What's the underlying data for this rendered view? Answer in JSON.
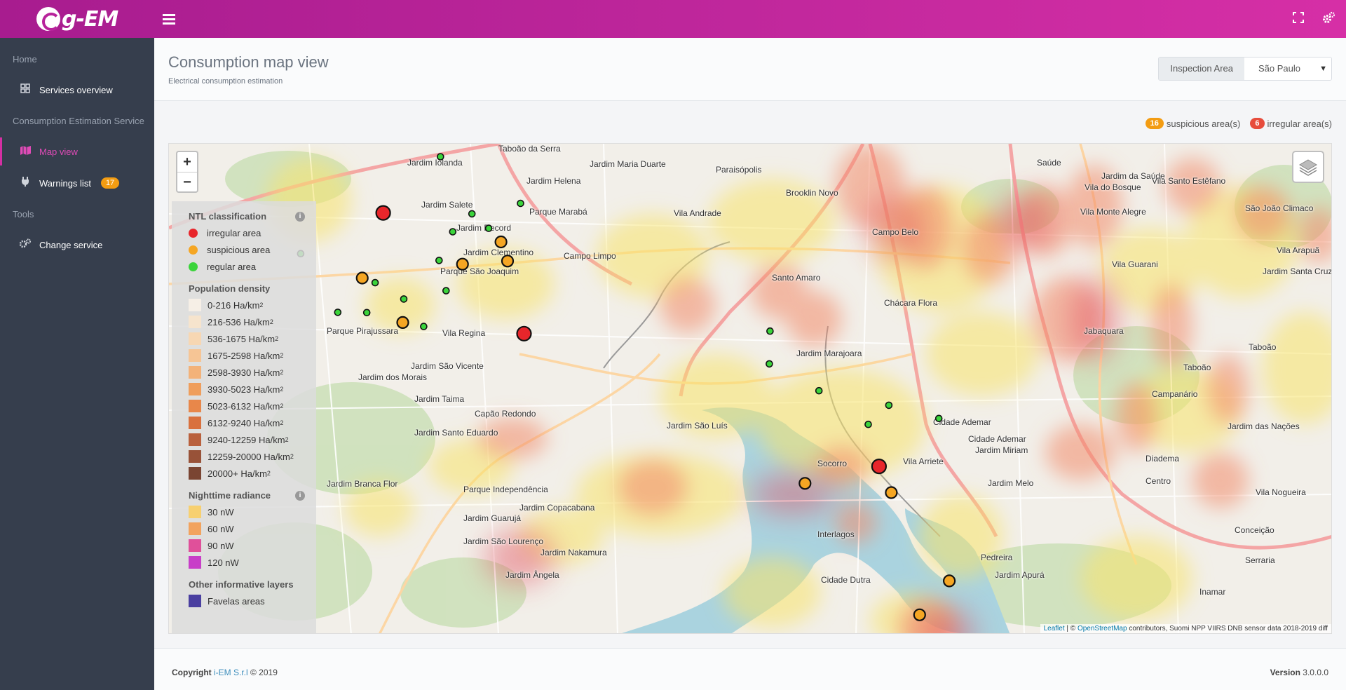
{
  "app": {
    "logo": "g-EM"
  },
  "sidebar": {
    "headers": {
      "home": "Home",
      "service": "Consumption Estimation Service",
      "tools": "Tools"
    },
    "items": [
      {
        "label": "Services overview",
        "icon": "grid-icon"
      },
      {
        "label": "Map view",
        "icon": "map-icon"
      },
      {
        "label": "Warnings list",
        "icon": "plug-icon",
        "badge": "17"
      },
      {
        "label": "Change service",
        "icon": "cogs-icon"
      }
    ]
  },
  "page": {
    "title": "Consumption map view",
    "subtitle": "Electrical consumption estimation"
  },
  "inspection": {
    "label": "Inspection Area",
    "value": "São Paulo"
  },
  "counters": {
    "suspicious_count": "16",
    "suspicious_label": "suspicious area(s)",
    "irregular_count": "6",
    "irregular_label": "irregular area(s)"
  },
  "legend": {
    "ntl_title": "NTL classification",
    "ntl": [
      {
        "label": "irregular area",
        "color": "#e8262b"
      },
      {
        "label": "suspicious area",
        "color": "#f5a623"
      },
      {
        "label": "regular area",
        "color": "#3bd43b"
      }
    ],
    "pop_title": "Population density",
    "pop": [
      {
        "label": "0-216 Ha/km",
        "color": "#f6efe6"
      },
      {
        "label": "216-536 Ha/km",
        "color": "#f6e4cd"
      },
      {
        "label": "536-1675 Ha/km",
        "color": "#f7d7b3"
      },
      {
        "label": "1675-2598 Ha/km",
        "color": "#f6c595"
      },
      {
        "label": "2598-3930 Ha/km",
        "color": "#f3b279"
      },
      {
        "label": "3930-5023 Ha/km",
        "color": "#ef9e5c"
      },
      {
        "label": "5023-6132 Ha/km",
        "color": "#e8874a"
      },
      {
        "label": "6132-9240 Ha/km",
        "color": "#d9713e"
      },
      {
        "label": "9240-12259 Ha/km",
        "color": "#b9603c"
      },
      {
        "label": "12259-20000 Ha/km",
        "color": "#985238"
      },
      {
        "label": "20000+ Ha/km",
        "color": "#7a4532"
      }
    ],
    "rad_title": "Nighttime radiance",
    "rad": [
      {
        "label": "30 nW",
        "color": "#f7d070"
      },
      {
        "label": "60 nW",
        "color": "#f2a35e"
      },
      {
        "label": "90 nW",
        "color": "#e0509a"
      },
      {
        "label": "120 nW",
        "color": "#c83ec8"
      }
    ],
    "other_title": "Other informative layers",
    "other": [
      {
        "label": "Favelas areas",
        "color": "#4a3fa0"
      }
    ]
  },
  "map": {
    "zoom_in": "+",
    "zoom_out": "−",
    "attribution_leaflet": "Leaflet",
    "attribution_sep": " | © ",
    "attribution_osm": "OpenStreetMap",
    "attribution_rest": " contributors, Suomi NPP VIIRS DNB sensor data 2018-2019 diff",
    "labels": [
      "Taboão da Serra",
      "Jardim Iolanda",
      "Jardim Helena",
      "Jardim Maria Duarte",
      "Paraisópolis",
      "Jardim Salete",
      "Jardim Record",
      "Parque Marabá",
      "Vila Andrade",
      "Brooklin Novo",
      "Campo Belo",
      "Saúde",
      "Vila do Bosque",
      "Jardim da Saúde",
      "Vila Santo Estêfano",
      "São João Climaco",
      "Vila Monte Alegre",
      "Jardim Clementino",
      "Campo Limpo",
      "Santo Amaro",
      "Vila Guarani",
      "Vila Arapuã",
      "Jardim Santa Cruz",
      "Parque São Joaquim",
      "Chácara Flora",
      "Jabaquara",
      "Parque Pirajussara",
      "Vila Regina",
      "Jardim Marajoara",
      "Jardim São Vicente",
      "Jardim dos Morais",
      "Jardim Taima",
      "Taboão",
      "Campanário",
      "Capão Redondo",
      "Jardim São Luís",
      "Cidade Ademar",
      "Jardim Santo Eduardo",
      "Cidade Ademar",
      "Jardim Miriam",
      "Diadema",
      "Jardim das Nações",
      "Parque Independência",
      "Socorro",
      "Vila Arriete",
      "Jardim Melo",
      "Centro",
      "Jardim Branca Flor",
      "Jardim Copacabana",
      "Jardim Guarujá",
      "Vila Nogueira",
      "Conceição",
      "Interlagos",
      "Jardim São Lourenço",
      "Jardim Nakamura",
      "Pedreira",
      "Serraria",
      "Jardim Ângela",
      "Cidade Dutra",
      "Jardim Apurá",
      "Inamar",
      "Taboão"
    ],
    "points": [
      {
        "cls": "irregular",
        "lat": -23.6234,
        "lon": -46.7757
      },
      {
        "cls": "irregular",
        "lat": -23.6625,
        "lon": -46.7354
      },
      {
        "cls": "irregular",
        "lat": -23.7055,
        "lon": -46.6338
      },
      {
        "cls": "suspicious",
        "lat": -23.6445,
        "lon": -46.7817
      },
      {
        "cls": "suspicious",
        "lat": -23.6589,
        "lon": -46.7701
      },
      {
        "cls": "suspicious",
        "lat": -23.64,
        "lon": -46.753
      },
      {
        "cls": "suspicious",
        "lat": -23.6328,
        "lon": -46.742
      },
      {
        "cls": "suspicious",
        "lat": -23.639,
        "lon": -46.7401
      },
      {
        "cls": "suspicious",
        "lat": -23.711,
        "lon": -46.655
      },
      {
        "cls": "suspicious",
        "lat": -23.714,
        "lon": -46.6303
      },
      {
        "cls": "suspicious",
        "lat": -23.7426,
        "lon": -46.6137
      },
      {
        "cls": "suspicious",
        "lat": -23.7536,
        "lon": -46.6222
      },
      {
        "cls": "regular",
        "lat": -23.6052,
        "lon": -46.7593
      },
      {
        "cls": "regular",
        "lat": -23.6237,
        "lon": -46.7503
      },
      {
        "cls": "regular",
        "lat": -23.6203,
        "lon": -46.7364
      },
      {
        "cls": "regular",
        "lat": -23.6295,
        "lon": -46.7558
      },
      {
        "cls": "regular",
        "lat": -23.6284,
        "lon": -46.7455
      },
      {
        "cls": "regular",
        "lat": -23.6366,
        "lon": -46.7993
      },
      {
        "cls": "regular",
        "lat": -23.6388,
        "lon": -46.7597
      },
      {
        "cls": "regular",
        "lat": -23.646,
        "lon": -46.778
      },
      {
        "cls": "regular",
        "lat": -23.6513,
        "lon": -46.7698
      },
      {
        "cls": "regular",
        "lat": -23.6486,
        "lon": -46.7577
      },
      {
        "cls": "regular",
        "lat": -23.6556,
        "lon": -46.7887
      },
      {
        "cls": "regular",
        "lat": -23.6557,
        "lon": -46.7804
      },
      {
        "cls": "regular",
        "lat": -23.6602,
        "lon": -46.7641
      },
      {
        "cls": "regular",
        "lat": -23.6617,
        "lon": -46.665
      },
      {
        "cls": "regular",
        "lat": -23.6723,
        "lon": -46.6652
      },
      {
        "cls": "regular",
        "lat": -23.681,
        "lon": -46.651
      },
      {
        "cls": "regular",
        "lat": -23.6857,
        "lon": -46.631
      },
      {
        "cls": "regular",
        "lat": -23.6919,
        "lon": -46.6369
      },
      {
        "cls": "regular",
        "lat": -23.69,
        "lon": -46.6167
      }
    ]
  },
  "footer": {
    "copy_prefix": "Copyright ",
    "copy_link": "i-EM S.r.l",
    "copy_suffix": " © 2019",
    "version_label": "Version",
    "version": "3.0.0.0"
  }
}
